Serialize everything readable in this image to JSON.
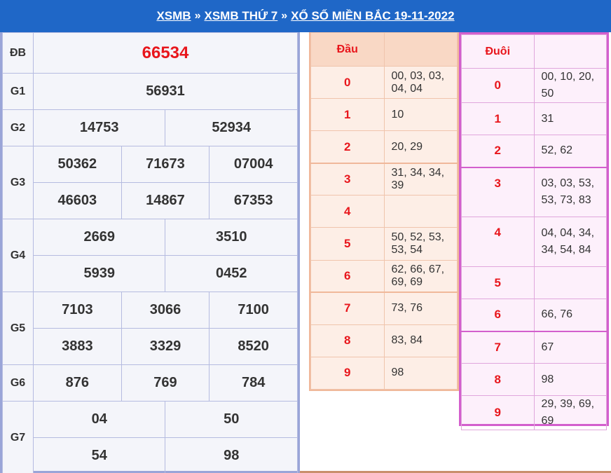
{
  "breadcrumb": {
    "home": "XSMB",
    "day": "XSMB THỨ 7",
    "current": "XỔ SỐ MIỀN BẮC 19-11-2022",
    "separator": "»"
  },
  "prizes": {
    "db": {
      "label": "ĐB",
      "numbers": [
        "66534"
      ]
    },
    "g1": {
      "label": "G1",
      "numbers": [
        "56931"
      ]
    },
    "g2": {
      "label": "G2",
      "numbers": [
        "14753",
        "52934"
      ]
    },
    "g3": {
      "label": "G3",
      "numbers": [
        "50362",
        "71673",
        "07004",
        "46603",
        "14867",
        "67353"
      ]
    },
    "g4": {
      "label": "G4",
      "numbers": [
        "2669",
        "3510",
        "5939",
        "0452"
      ]
    },
    "g5": {
      "label": "G5",
      "numbers": [
        "7103",
        "3066",
        "7100",
        "3883",
        "3329",
        "8520"
      ]
    },
    "g6": {
      "label": "G6",
      "numbers": [
        "876",
        "769",
        "784"
      ]
    },
    "g7": {
      "label": "G7",
      "numbers": [
        "04",
        "50",
        "54",
        "98"
      ]
    }
  },
  "dau": {
    "header": "Đầu",
    "rows": [
      {
        "key": "0",
        "value": "00, 03, 03, 04, 04"
      },
      {
        "key": "1",
        "value": "10"
      },
      {
        "key": "2",
        "value": "20, 29"
      },
      {
        "key": "3",
        "value": "31, 34, 34, 39"
      },
      {
        "key": "4",
        "value": ""
      },
      {
        "key": "5",
        "value": "50, 52, 53, 53, 54"
      },
      {
        "key": "6",
        "value": "62, 66, 67, 69, 69"
      },
      {
        "key": "7",
        "value": "73, 76"
      },
      {
        "key": "8",
        "value": "83, 84"
      },
      {
        "key": "9",
        "value": "98"
      }
    ]
  },
  "duoi": {
    "header": "Đuôi",
    "rows": [
      {
        "key": "0",
        "value": "00, 10, 20, 50"
      },
      {
        "key": "1",
        "value": "31"
      },
      {
        "key": "2",
        "value": "52, 62"
      },
      {
        "key": "3",
        "value": "03, 03, 53, 53, 73, 83"
      },
      {
        "key": "4",
        "value": "04, 04, 34, 34, 54, 84"
      },
      {
        "key": "5",
        "value": ""
      },
      {
        "key": "6",
        "value": "66, 76"
      },
      {
        "key": "7",
        "value": "67"
      },
      {
        "key": "8",
        "value": "98"
      },
      {
        "key": "9",
        "value": "29, 39, 69, 69"
      }
    ]
  }
}
